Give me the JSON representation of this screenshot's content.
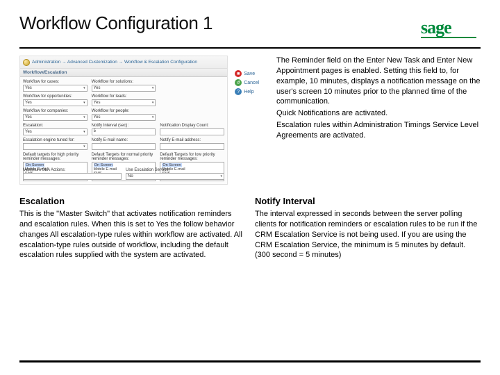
{
  "title": "Workflow Configuration 1",
  "brand": {
    "name": "sage",
    "color": "#008a3c"
  },
  "panel": {
    "breadcrumb": "Administration → Advanced Customization → Workflow & Escalation Configuration",
    "section_header": "Workflow/Escalation",
    "actions": {
      "save": "Save",
      "cancel": "Cancel",
      "help": "Help"
    },
    "row1": [
      {
        "label": "Workflow for cases:",
        "value": "Yes"
      },
      {
        "label": "Workflow for solutions:",
        "value": "Yes"
      },
      {
        "label": "",
        "value": ""
      }
    ],
    "row2": [
      {
        "label": "Workflow for opportunities:",
        "value": "Yes"
      },
      {
        "label": "Workflow for leads:",
        "value": "Yes"
      },
      {
        "label": "",
        "value": ""
      }
    ],
    "row3": [
      {
        "label": "Workflow for companies:",
        "value": "Yes"
      },
      {
        "label": "Workflow for people:",
        "value": "Yes"
      },
      {
        "label": "",
        "value": ""
      }
    ],
    "row4": [
      {
        "label": "Escalation:",
        "value": "Yes"
      },
      {
        "label": "Notify Interval (sec):",
        "value": "5"
      },
      {
        "label": "Notification Display Count:",
        "value": ""
      }
    ],
    "row5": [
      {
        "label": "Escalation engine tuned for:",
        "value": ""
      },
      {
        "label": "Notify E-mail name:",
        "value": ""
      },
      {
        "label": "Notify E-mail address:",
        "value": ""
      }
    ],
    "targets": {
      "high": {
        "label": "Default targets for high priority reminder messages:",
        "items": [
          "On Screen",
          "Mobile E-mail",
          "SMS"
        ],
        "selected": "On Screen"
      },
      "normal": {
        "label": "Default Targets for normal priority reminder messages:",
        "items": [
          "On Screen",
          "Mobile E-mail",
          "SMS"
        ],
        "selected": "On Screen"
      },
      "low": {
        "label": "Default Targets for low priority reminder messages:",
        "items": [
          "On Screen",
          "Mobile E-mail",
          "SMS"
        ],
        "selected": "On Screen"
      }
    },
    "bottom": [
      {
        "label": "Maximum SLA Actions:",
        "value": ""
      },
      {
        "label": "Use Escalation Service:",
        "value": "No"
      }
    ]
  },
  "intro": {
    "p1": "The Reminder field on the Enter New Task and Enter New Appointment pages is enabled. Setting this field to, for example, 10 minutes, displays a notification message on the user's screen 10 minutes prior to the planned time of the communication.",
    "p2": "Quick Notifications are activated.",
    "p3": "Escalation rules within Administration Timings Service Level Agreements are activated."
  },
  "lower": {
    "escalation": {
      "heading": "Escalation",
      "body": "This is the \"Master Switch\" that activates notification reminders and escalation rules. When this is set to Yes the follow behavior changes\nAll escalation-type rules within workflow are activated.\nAll escalation-type rules outside of workflow, including the default escalation rules supplied with the system are activated."
    },
    "notify": {
      "heading": "Notify Interval",
      "body": "The interval expressed in seconds between the server polling clients for notification reminders or escalation rules to be run if the CRM Escalation Service is not being used. If you are using the CRM Escalation Service, the minimum is 5 minutes by default. (300 second = 5 minutes)"
    }
  }
}
